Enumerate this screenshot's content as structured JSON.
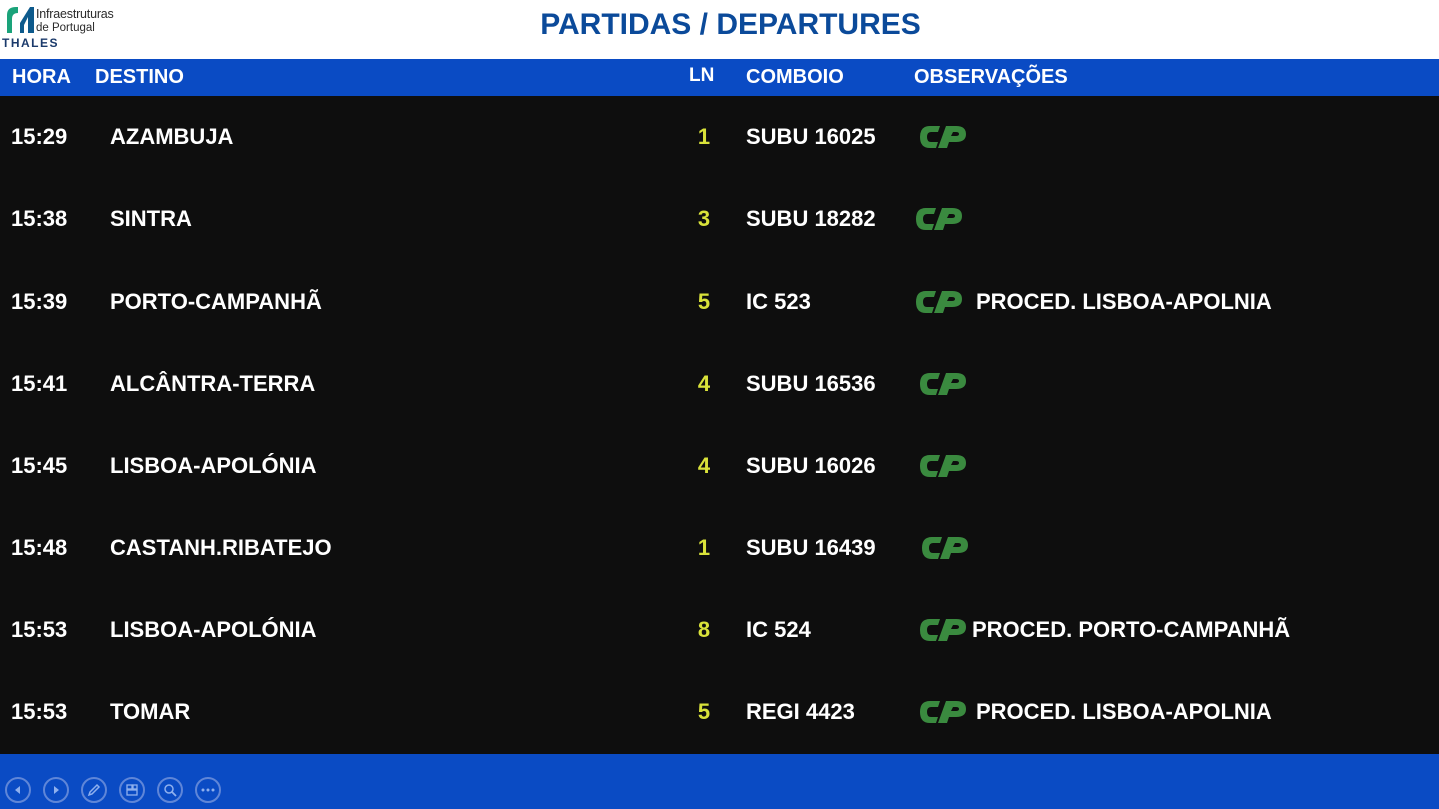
{
  "logo": {
    "line1": "Infraestruturas",
    "line2": "de Portugal",
    "brand": "THALES"
  },
  "title": "PARTIDAS / DEPARTURES",
  "columns": {
    "hora": "HORA",
    "destino": "DESTINO",
    "ln": "LN",
    "comboio": "COMBOIO",
    "observacoes": "OBSERVAÇÕES"
  },
  "departures": [
    {
      "time": "15:29",
      "destination": "AZAMBUJA",
      "line": "1",
      "train": "SUBU 16025",
      "icon": "cp-logo-icon",
      "note": ""
    },
    {
      "time": "15:38",
      "destination": "SINTRA",
      "line": "3",
      "train": "SUBU 18282",
      "icon": "cp-logo-icon",
      "note": ""
    },
    {
      "time": "15:39",
      "destination": "PORTO-CAMPANHÃ",
      "line": "5",
      "train": "IC 523",
      "icon": "cp-logo-icon",
      "note": "PROCED. LISBOA-APOLNIA"
    },
    {
      "time": "15:41",
      "destination": "ALCÂNTRA-TERRA",
      "line": "4",
      "train": "SUBU 16536",
      "icon": "cp-logo-icon",
      "note": ""
    },
    {
      "time": "15:45",
      "destination": "LISBOA-APOLÓNIA",
      "line": "4",
      "train": "SUBU 16026",
      "icon": "cp-logo-icon",
      "note": ""
    },
    {
      "time": "15:48",
      "destination": "CASTANH.RIBATEJO",
      "line": "1",
      "train": "SUBU 16439",
      "icon": "cp-logo-icon",
      "note": ""
    },
    {
      "time": "15:53",
      "destination": "LISBOA-APOLÓNIA",
      "line": "8",
      "train": "IC 524",
      "icon": "cp-logo-icon",
      "note": "PROCED. PORTO-CAMPANHÃ"
    },
    {
      "time": "15:53",
      "destination": "TOMAR",
      "line": "5",
      "train": "REGI 4423",
      "icon": "cp-logo-icon",
      "note": "PROCED. LISBOA-APOLNIA"
    }
  ],
  "controls": [
    {
      "name": "previous-slide-icon"
    },
    {
      "name": "next-slide-icon"
    },
    {
      "name": "pen-icon"
    },
    {
      "name": "slides-grid-icon"
    },
    {
      "name": "zoom-icon"
    },
    {
      "name": "more-options-icon"
    }
  ],
  "colors": {
    "header_blue": "#0a4bc4",
    "title_blue": "#0b4a9a",
    "board_bg": "#0e0e0e",
    "line_yellow": "#d9e23a",
    "cp_green": "#3a8a3f"
  }
}
